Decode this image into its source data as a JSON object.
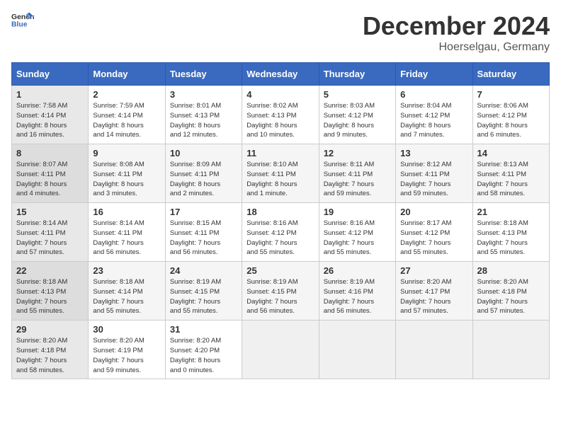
{
  "header": {
    "logo_line1": "General",
    "logo_line2": "Blue",
    "title": "December 2024",
    "subtitle": "Hoerselgau, Germany"
  },
  "weekdays": [
    "Sunday",
    "Monday",
    "Tuesday",
    "Wednesday",
    "Thursday",
    "Friday",
    "Saturday"
  ],
  "weeks": [
    [
      {
        "day": "1",
        "info": "Sunrise: 7:58 AM\nSunset: 4:14 PM\nDaylight: 8 hours\nand 16 minutes."
      },
      {
        "day": "2",
        "info": "Sunrise: 7:59 AM\nSunset: 4:14 PM\nDaylight: 8 hours\nand 14 minutes."
      },
      {
        "day": "3",
        "info": "Sunrise: 8:01 AM\nSunset: 4:13 PM\nDaylight: 8 hours\nand 12 minutes."
      },
      {
        "day": "4",
        "info": "Sunrise: 8:02 AM\nSunset: 4:13 PM\nDaylight: 8 hours\nand 10 minutes."
      },
      {
        "day": "5",
        "info": "Sunrise: 8:03 AM\nSunset: 4:12 PM\nDaylight: 8 hours\nand 9 minutes."
      },
      {
        "day": "6",
        "info": "Sunrise: 8:04 AM\nSunset: 4:12 PM\nDaylight: 8 hours\nand 7 minutes."
      },
      {
        "day": "7",
        "info": "Sunrise: 8:06 AM\nSunset: 4:12 PM\nDaylight: 8 hours\nand 6 minutes."
      }
    ],
    [
      {
        "day": "8",
        "info": "Sunrise: 8:07 AM\nSunset: 4:11 PM\nDaylight: 8 hours\nand 4 minutes."
      },
      {
        "day": "9",
        "info": "Sunrise: 8:08 AM\nSunset: 4:11 PM\nDaylight: 8 hours\nand 3 minutes."
      },
      {
        "day": "10",
        "info": "Sunrise: 8:09 AM\nSunset: 4:11 PM\nDaylight: 8 hours\nand 2 minutes."
      },
      {
        "day": "11",
        "info": "Sunrise: 8:10 AM\nSunset: 4:11 PM\nDaylight: 8 hours\nand 1 minute."
      },
      {
        "day": "12",
        "info": "Sunrise: 8:11 AM\nSunset: 4:11 PM\nDaylight: 7 hours\nand 59 minutes."
      },
      {
        "day": "13",
        "info": "Sunrise: 8:12 AM\nSunset: 4:11 PM\nDaylight: 7 hours\nand 59 minutes."
      },
      {
        "day": "14",
        "info": "Sunrise: 8:13 AM\nSunset: 4:11 PM\nDaylight: 7 hours\nand 58 minutes."
      }
    ],
    [
      {
        "day": "15",
        "info": "Sunrise: 8:14 AM\nSunset: 4:11 PM\nDaylight: 7 hours\nand 57 minutes."
      },
      {
        "day": "16",
        "info": "Sunrise: 8:14 AM\nSunset: 4:11 PM\nDaylight: 7 hours\nand 56 minutes."
      },
      {
        "day": "17",
        "info": "Sunrise: 8:15 AM\nSunset: 4:11 PM\nDaylight: 7 hours\nand 56 minutes."
      },
      {
        "day": "18",
        "info": "Sunrise: 8:16 AM\nSunset: 4:12 PM\nDaylight: 7 hours\nand 55 minutes."
      },
      {
        "day": "19",
        "info": "Sunrise: 8:16 AM\nSunset: 4:12 PM\nDaylight: 7 hours\nand 55 minutes."
      },
      {
        "day": "20",
        "info": "Sunrise: 8:17 AM\nSunset: 4:12 PM\nDaylight: 7 hours\nand 55 minutes."
      },
      {
        "day": "21",
        "info": "Sunrise: 8:18 AM\nSunset: 4:13 PM\nDaylight: 7 hours\nand 55 minutes."
      }
    ],
    [
      {
        "day": "22",
        "info": "Sunrise: 8:18 AM\nSunset: 4:13 PM\nDaylight: 7 hours\nand 55 minutes."
      },
      {
        "day": "23",
        "info": "Sunrise: 8:18 AM\nSunset: 4:14 PM\nDaylight: 7 hours\nand 55 minutes."
      },
      {
        "day": "24",
        "info": "Sunrise: 8:19 AM\nSunset: 4:15 PM\nDaylight: 7 hours\nand 55 minutes."
      },
      {
        "day": "25",
        "info": "Sunrise: 8:19 AM\nSunset: 4:15 PM\nDaylight: 7 hours\nand 56 minutes."
      },
      {
        "day": "26",
        "info": "Sunrise: 8:19 AM\nSunset: 4:16 PM\nDaylight: 7 hours\nand 56 minutes."
      },
      {
        "day": "27",
        "info": "Sunrise: 8:20 AM\nSunset: 4:17 PM\nDaylight: 7 hours\nand 57 minutes."
      },
      {
        "day": "28",
        "info": "Sunrise: 8:20 AM\nSunset: 4:18 PM\nDaylight: 7 hours\nand 57 minutes."
      }
    ],
    [
      {
        "day": "29",
        "info": "Sunrise: 8:20 AM\nSunset: 4:18 PM\nDaylight: 7 hours\nand 58 minutes."
      },
      {
        "day": "30",
        "info": "Sunrise: 8:20 AM\nSunset: 4:19 PM\nDaylight: 7 hours\nand 59 minutes."
      },
      {
        "day": "31",
        "info": "Sunrise: 8:20 AM\nSunset: 4:20 PM\nDaylight: 8 hours\nand 0 minutes."
      },
      {
        "day": "",
        "info": ""
      },
      {
        "day": "",
        "info": ""
      },
      {
        "day": "",
        "info": ""
      },
      {
        "day": "",
        "info": ""
      }
    ]
  ]
}
